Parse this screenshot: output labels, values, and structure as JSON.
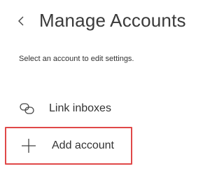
{
  "header": {
    "title": "Manage Accounts",
    "back_icon": "chevron-left-icon"
  },
  "subtitle": "Select an account to edit settings.",
  "menu": [
    {
      "label": "Link inboxes",
      "icon": "link-icon"
    },
    {
      "label": "Add account",
      "icon": "plus-icon",
      "highlighted": true
    }
  ],
  "colors": {
    "highlight_border": "#e04848",
    "text": "#333333"
  }
}
